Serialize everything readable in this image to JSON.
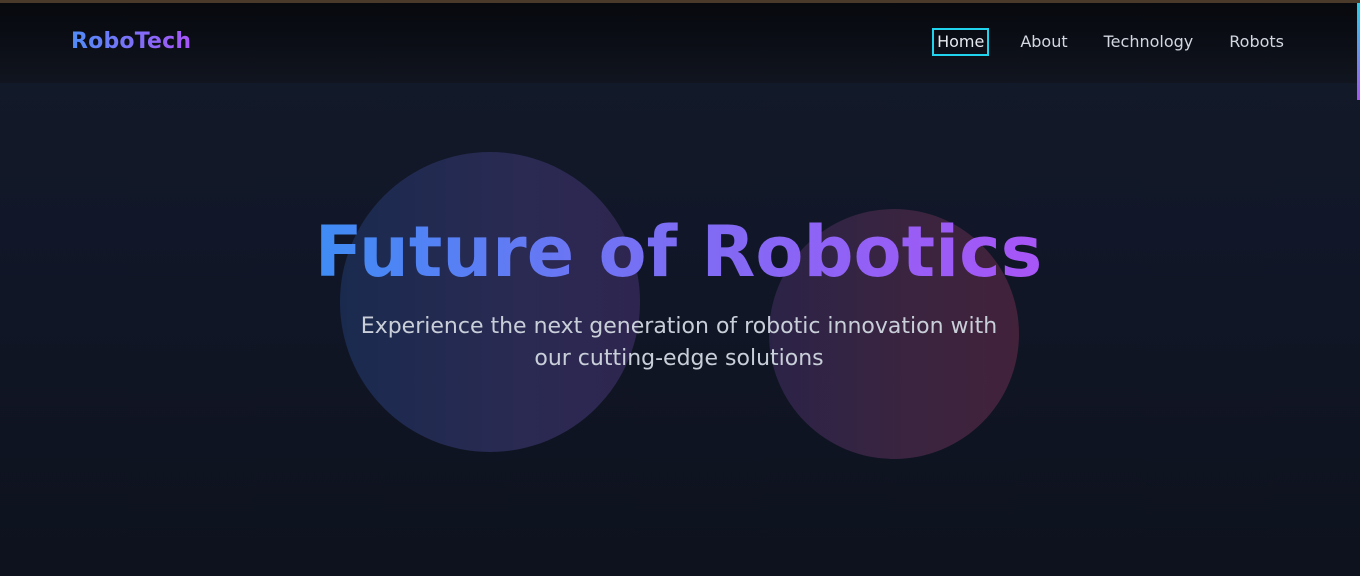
{
  "brand": {
    "name": "RoboTech"
  },
  "nav": {
    "items": [
      {
        "label": "Home",
        "active": true
      },
      {
        "label": "About",
        "active": false
      },
      {
        "label": "Technology",
        "active": false
      },
      {
        "label": "Robots",
        "active": false
      }
    ]
  },
  "hero": {
    "title": "Future of Robotics",
    "subtitle": "Experience the next generation of robotic innovation with our cutting-edge solutions"
  },
  "colors": {
    "background": "#0f1320",
    "gradient_start": "#3f8cf5",
    "gradient_end": "#a855f7",
    "focus_outline": "#22d3ee",
    "nav_text": "#d3d7df",
    "subtitle_text": "#c9cfd9"
  }
}
